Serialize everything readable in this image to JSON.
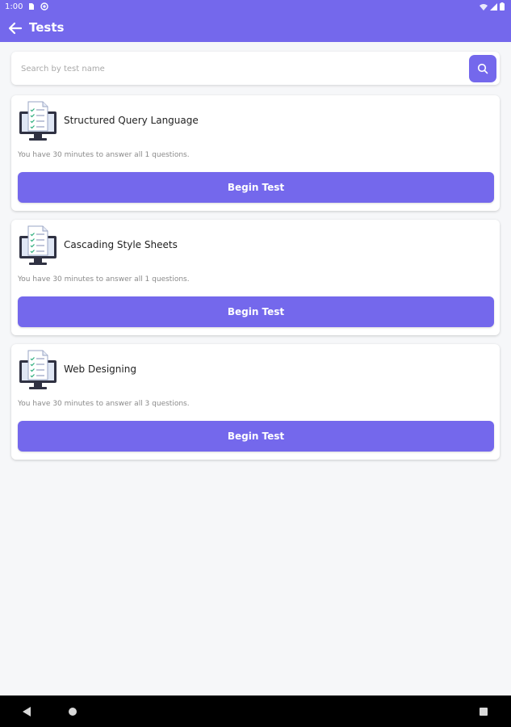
{
  "status_bar": {
    "time": "1:00",
    "icons": [
      "sim-card-icon",
      "vpn-icon",
      "wifi-icon",
      "signal-icon",
      "battery-icon"
    ]
  },
  "app_bar": {
    "title": "Tests",
    "back_icon": "arrow-left-icon",
    "color": "#7468ec"
  },
  "search": {
    "placeholder": "Search by test name",
    "value": "",
    "button_icon": "search-icon"
  },
  "tests": [
    {
      "name": "Structured Query Language",
      "description": "You have 30 minutes to answer all 1 questions.",
      "button_label": "Begin Test",
      "icon": "monitor-checklist-icon"
    },
    {
      "name": "Cascading Style Sheets",
      "description": "You have 30 minutes to answer all 1 questions.",
      "button_label": "Begin Test",
      "icon": "monitor-checklist-icon"
    },
    {
      "name": "Web Designing",
      "description": "You have 30 minutes to answer all 3 questions.",
      "button_label": "Begin Test",
      "icon": "monitor-checklist-icon"
    }
  ],
  "nav_bar": {
    "buttons": [
      "nav-back-icon",
      "nav-home-icon",
      "nav-recents-icon"
    ]
  },
  "colors": {
    "accent": "#7468ec",
    "background": "#f6f7f9",
    "card": "#ffffff"
  }
}
